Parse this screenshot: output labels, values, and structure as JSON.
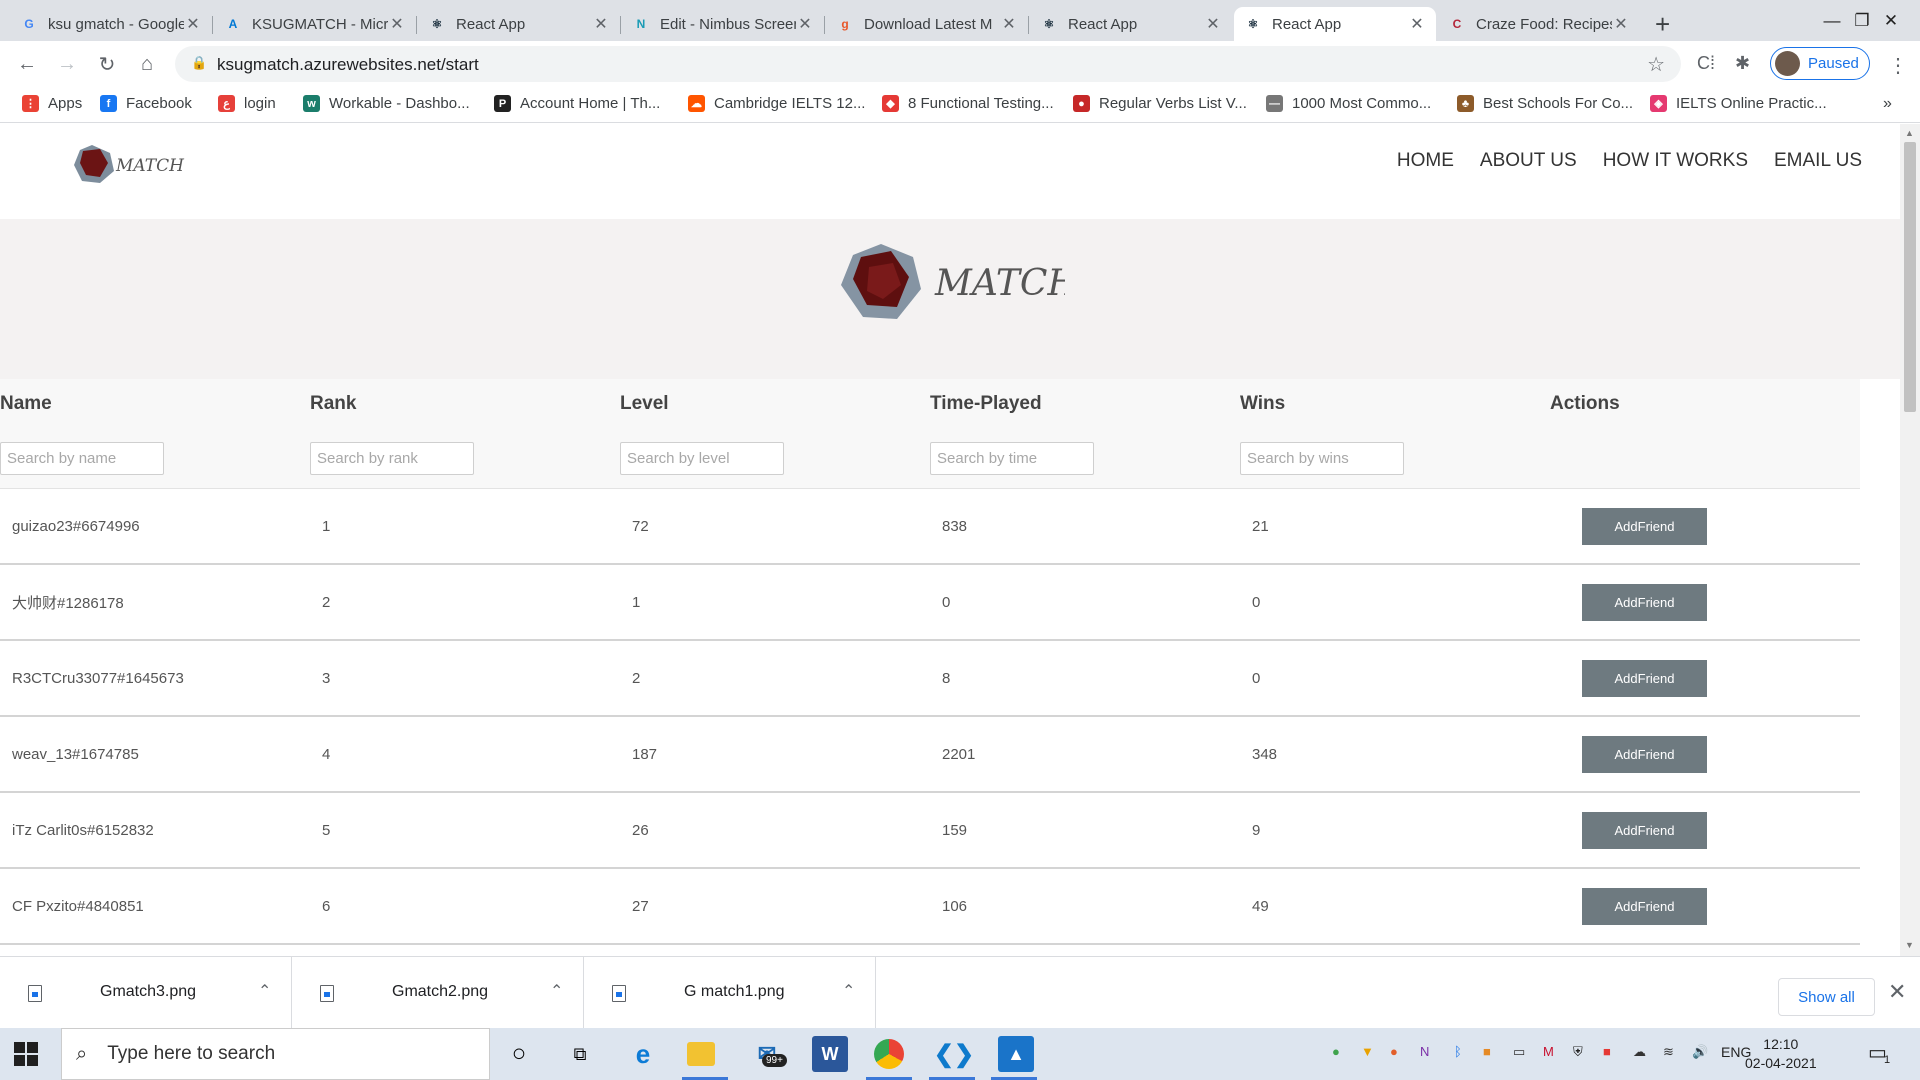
{
  "browser": {
    "tabs": [
      {
        "title": "ksu gmatch - Google",
        "icon": "google-icon",
        "color": "#4285f4",
        "glyph": "G"
      },
      {
        "title": "KSUGMATCH - Microsoft",
        "icon": "azure-icon",
        "color": "#0078d4",
        "glyph": "A"
      },
      {
        "title": "React App",
        "icon": "react-icon",
        "color": "#1f3342",
        "glyph": "⚛"
      },
      {
        "title": "Edit - Nimbus Screenshot",
        "icon": "nimbus-icon",
        "color": "#1a9bb5",
        "glyph": "N"
      },
      {
        "title": "Download Latest M",
        "icon": "download-site-icon",
        "color": "#e8572a",
        "glyph": "g"
      },
      {
        "title": "React App",
        "icon": "react-icon",
        "color": "#1f3342",
        "glyph": "⚛"
      },
      {
        "title": "React App",
        "icon": "react-icon",
        "color": "#1f3342",
        "glyph": "⚛"
      },
      {
        "title": "Craze Food: Recipes",
        "icon": "craze-food-icon",
        "color": "#b3263a",
        "glyph": "C"
      }
    ],
    "active_tab": 6,
    "url": "ksugmatch.azurewebsites.net/start",
    "profile_label": "Paused",
    "bookmarks": [
      {
        "label": "Apps",
        "icon": "apps-grid-icon",
        "color": "#ea4335",
        "glyph": "⋮"
      },
      {
        "label": "Facebook",
        "icon": "facebook-icon",
        "color": "#1877f2",
        "glyph": "f"
      },
      {
        "label": "login",
        "icon": "login-icon",
        "color": "#e6403a",
        "glyph": "ع"
      },
      {
        "label": "Workable - Dashbo...",
        "icon": "workable-icon",
        "color": "#1b7d6b",
        "glyph": "w"
      },
      {
        "label": "Account Home | Th...",
        "icon": "account-home-icon",
        "color": "#222222",
        "glyph": "P"
      },
      {
        "label": "Cambridge IELTS 12...",
        "icon": "soundcloud-icon",
        "color": "#ff5500",
        "glyph": "☁"
      },
      {
        "label": "8 Functional Testing...",
        "icon": "testing-icon",
        "color": "#e53935",
        "glyph": "◆"
      },
      {
        "label": "Regular Verbs List V...",
        "icon": "verbs-icon",
        "color": "#c62828",
        "glyph": "●"
      },
      {
        "label": "1000 Most Commo...",
        "icon": "common-words-icon",
        "color": "#777777",
        "glyph": "—"
      },
      {
        "label": "Best Schools For Co...",
        "icon": "owl-icon",
        "color": "#8d5b2a",
        "glyph": "♣"
      },
      {
        "label": "IELTS Online Practic...",
        "icon": "ielts-icon",
        "color": "#e53970",
        "glyph": "◈"
      }
    ]
  },
  "site": {
    "logo_text": "MATCH",
    "nav": [
      "HOME",
      "ABOUT US",
      "HOW IT WORKS",
      "EMAIL US"
    ]
  },
  "table": {
    "headers": [
      "Name",
      "Rank",
      "Level",
      "Time-Played",
      "Wins",
      "Actions"
    ],
    "placeholders": [
      "Search by name",
      "Search by rank",
      "Search by level",
      "Search by time",
      "Search by wins"
    ],
    "action_label": "AddFriend",
    "rows": [
      {
        "name": "guizao23#6674996",
        "rank": "1",
        "level": "72",
        "time": "838",
        "wins": "21"
      },
      {
        "name": "大帅财#1286178",
        "rank": "2",
        "level": "1",
        "time": "0",
        "wins": "0"
      },
      {
        "name": "R3CTCru33077#1645673",
        "rank": "3",
        "level": "2",
        "time": "8",
        "wins": "0"
      },
      {
        "name": "weav_13#1674785",
        "rank": "4",
        "level": "187",
        "time": "2201",
        "wins": "348"
      },
      {
        "name": "iTz Carlit0s#6152832",
        "rank": "5",
        "level": "26",
        "time": "159",
        "wins": "9"
      },
      {
        "name": "CF Pxzito#4840851",
        "rank": "6",
        "level": "27",
        "time": "106",
        "wins": "49"
      }
    ]
  },
  "downloads": {
    "files": [
      "Gmatch3.png",
      "Gmatch2.png",
      "G match1.png"
    ],
    "show_all": "Show all"
  },
  "taskbar": {
    "search_placeholder": "Type here to search",
    "mail_badge": "99+",
    "lang": "ENG",
    "time": "12:10",
    "date": "02-04-2021",
    "notification_count": "1"
  }
}
